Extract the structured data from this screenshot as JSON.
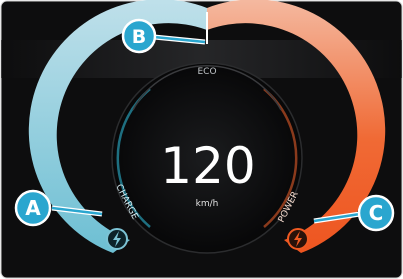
{
  "gauge": {
    "speed_value": "120",
    "speed_unit": "km/h",
    "eco_label": "ECO",
    "charge_label": "CHARGE",
    "power_label": "POWER",
    "icons": {
      "charge": "lightning-bolt-icon",
      "power": "lightning-bolt-icon"
    }
  },
  "callouts": [
    {
      "letter": "A"
    },
    {
      "letter": "B"
    },
    {
      "letter": "C"
    }
  ],
  "colors": {
    "background": "#0d0d0e",
    "charge_arc": "#7cc3d5",
    "power_arc": "#f05a22",
    "power_arc_top": "#f2a07e",
    "callout_fill": "#2aa6cf",
    "text": "#ffffff"
  }
}
